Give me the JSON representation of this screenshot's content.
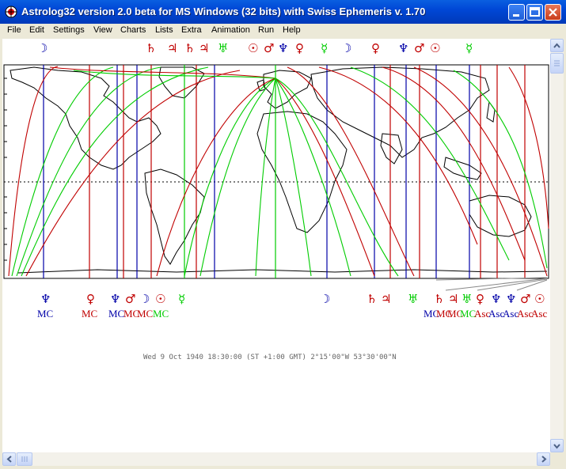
{
  "window": {
    "title": "Astrolog32 version 2.0 beta for MS Windows (32 bits) with Swiss Ephemeris v. 1.70"
  },
  "menu": [
    {
      "label": "File"
    },
    {
      "label": "Edit"
    },
    {
      "label": "Settings"
    },
    {
      "label": "View"
    },
    {
      "label": "Charts"
    },
    {
      "label": "Lists"
    },
    {
      "label": "Extra"
    },
    {
      "label": "Animation"
    },
    {
      "label": "Run"
    },
    {
      "label": "Help"
    }
  ],
  "colors": {
    "red": "#c00000",
    "blue": "#0000a8",
    "green": "#00cc00",
    "map": "#000000"
  },
  "map": {
    "top_glyphs": [
      {
        "g": "☽",
        "c": "blue"
      },
      {
        "g": "♄",
        "c": "red"
      },
      {
        "g": "♃",
        "c": "red"
      },
      {
        "g": "♄",
        "c": "red"
      },
      {
        "g": "♃",
        "c": "red"
      },
      {
        "g": "♅",
        "c": "green"
      },
      {
        "g": "☉",
        "c": "red"
      },
      {
        "g": "♂",
        "c": "red"
      },
      {
        "g": "♆",
        "c": "blue"
      },
      {
        "g": "♀",
        "c": "red"
      },
      {
        "g": "☿",
        "c": "green"
      },
      {
        "g": "☽",
        "c": "blue"
      },
      {
        "g": "♀",
        "c": "red"
      },
      {
        "g": "♆",
        "c": "blue"
      },
      {
        "g": "♂",
        "c": "red"
      },
      {
        "g": "☉",
        "c": "red"
      },
      {
        "g": "☿",
        "c": "green"
      }
    ],
    "bottom_glyphs": [
      {
        "g": "♆",
        "c": "blue"
      },
      {
        "g": "♀",
        "c": "red"
      },
      {
        "g": "♆",
        "c": "blue"
      },
      {
        "g": "♂",
        "c": "red"
      },
      {
        "g": "☽",
        "c": "blue"
      },
      {
        "g": "☉",
        "c": "red"
      },
      {
        "g": "☿",
        "c": "green"
      },
      {
        "g": "☽",
        "c": "blue"
      },
      {
        "g": "♄",
        "c": "red"
      },
      {
        "g": "♃",
        "c": "red"
      },
      {
        "g": "♅",
        "c": "green"
      },
      {
        "g": "♄",
        "c": "red"
      },
      {
        "g": "♃",
        "c": "red"
      },
      {
        "g": "♅",
        "c": "green"
      },
      {
        "g": "♀",
        "c": "red"
      },
      {
        "g": "♆",
        "c": "blue"
      },
      {
        "g": "♆",
        "c": "blue"
      },
      {
        "g": "♂",
        "c": "red"
      },
      {
        "g": "☉",
        "c": "red"
      }
    ],
    "bottom_labels": [
      {
        "t": "MC",
        "c": "blue"
      },
      {
        "t": "MC",
        "c": "red"
      },
      {
        "t": "MC",
        "c": "blue"
      },
      {
        "t": "MC",
        "c": "red"
      },
      {
        "t": "MC",
        "c": "red"
      },
      {
        "t": "MC",
        "c": "green"
      },
      {
        "t": "MC",
        "c": "blue"
      },
      {
        "t": "MC",
        "c": "red"
      },
      {
        "t": "MC",
        "c": "red"
      },
      {
        "t": "MC",
        "c": "green"
      },
      {
        "t": "Asc",
        "c": "red"
      },
      {
        "t": "Asc",
        "c": "blue"
      },
      {
        "t": "Asc",
        "c": "blue"
      },
      {
        "t": "Asc",
        "c": "red"
      },
      {
        "t": "Asc",
        "c": "red"
      }
    ],
    "status": "Wed  9 Oct 1940 18:30:00 (ST +1:00 GMT)    2°15'00\"W 53°30'00\"N"
  }
}
